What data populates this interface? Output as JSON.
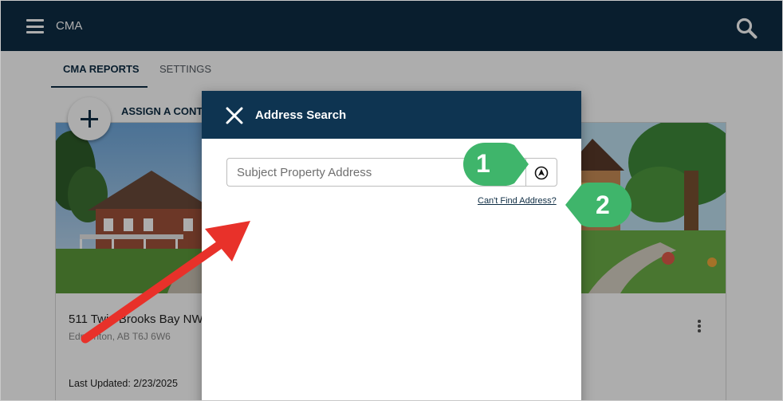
{
  "app": {
    "title": "CMA"
  },
  "tabs": [
    {
      "label": "CMA REPORTS",
      "active": true
    },
    {
      "label": "SETTINGS",
      "active": false
    }
  ],
  "assign": {
    "label": "ASSIGN A CONT"
  },
  "card": {
    "address": "511 Twin Brooks Bay NW",
    "city": "Edmonton, AB T6J 6W6",
    "last_updated": "Last Updated: 2/23/2025"
  },
  "modal": {
    "title": "Address Search",
    "input_placeholder": "Subject Property Address",
    "input_value": "",
    "cant_find_link": "Can't Find Address?"
  },
  "annotations": {
    "callout_1": "1",
    "callout_2": "2",
    "callout_color": "#3fb56b",
    "arrow_color": "#e8312a"
  },
  "colors": {
    "header_navy": "#0e2d44",
    "modal_header": "#0e3451"
  }
}
